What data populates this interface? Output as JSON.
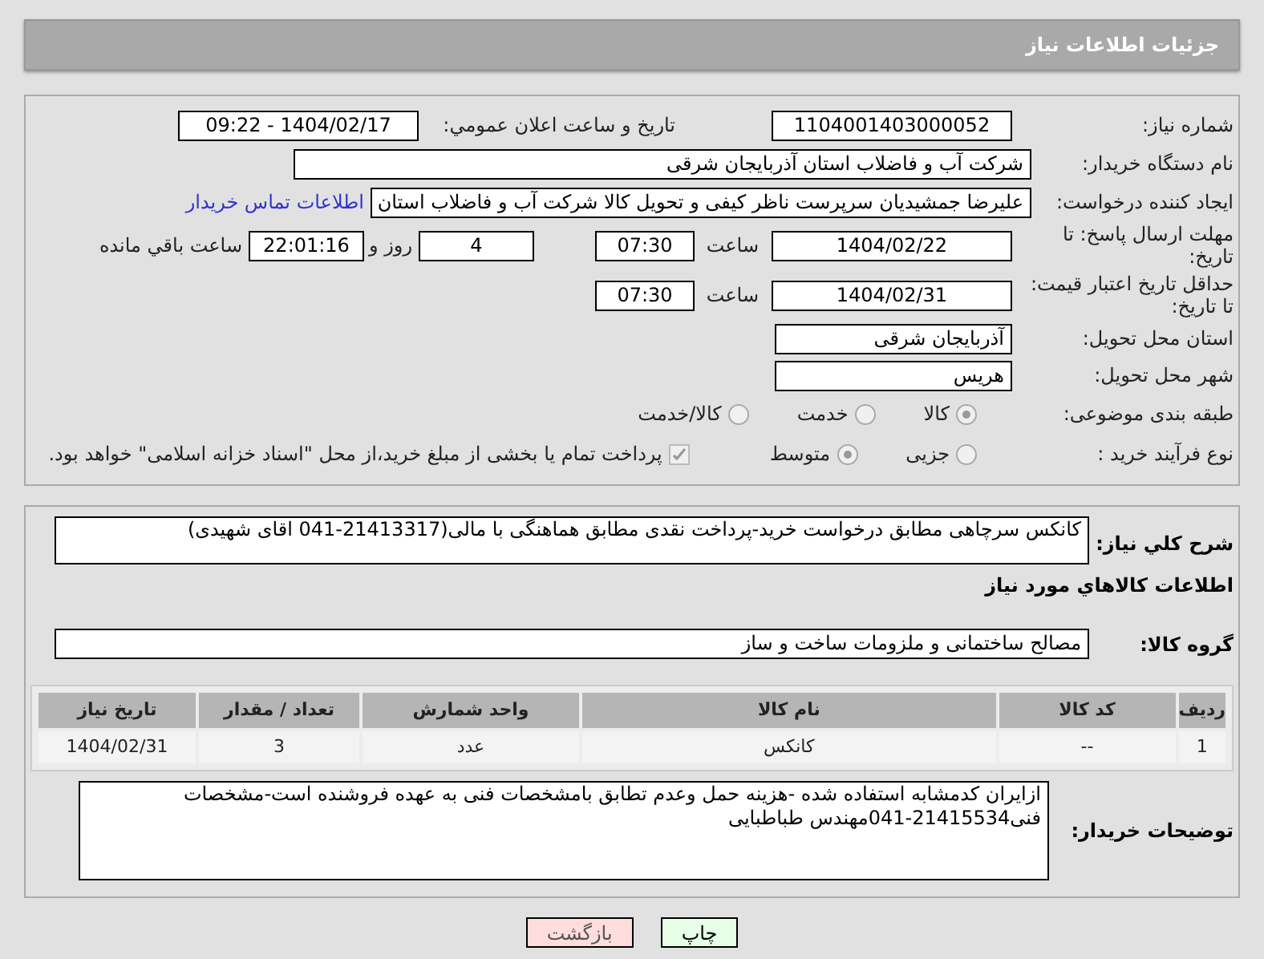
{
  "header": {
    "title": "جزئیات اطلاعات نیاز"
  },
  "need_number": {
    "label": "شماره نیاز:",
    "value": "1104001403000052"
  },
  "announce": {
    "label": "تاريخ و ساعت اعلان عمومي:",
    "value": "1404/02/17 - 09:22"
  },
  "buyer": {
    "label": "نام دستگاه خريدار:",
    "value": "شرکت آب و فاضلاب استان آذربایجان شرقی"
  },
  "creator": {
    "label": "ايجاد کننده درخواست:",
    "value": "علیرضا جمشیدیان سرپرست ناظر کیفی و تحویل کالا شرکت آب و فاضلاب استان",
    "link": "اطلاعات تماس خريدار"
  },
  "deadline": {
    "label": "مهلت ارسال پاسخ: تا تاريخ:",
    "date": "1404/02/22",
    "time_label": "ساعت",
    "time": "07:30",
    "days": "4",
    "days_label": "روز و",
    "remaining": "22:01:16",
    "remaining_label": "ساعت باقي مانده"
  },
  "validity": {
    "label": "حداقل تاريخ اعتبار قيمت: تا تاريخ:",
    "date": "1404/02/31",
    "time_label": "ساعت",
    "time": "07:30"
  },
  "province": {
    "label": "استان محل تحویل:",
    "value": "آذربایجان شرقی"
  },
  "city": {
    "label": "شهر محل تحویل:",
    "value": "هریس"
  },
  "category": {
    "label": "طبقه بندی موضوعی:",
    "options": [
      {
        "label": "کالا",
        "selected": true
      },
      {
        "label": "خدمت",
        "selected": false
      },
      {
        "label": "کالا/خدمت",
        "selected": false
      }
    ]
  },
  "process": {
    "label": "نوع فرآیند خرید :",
    "options": [
      {
        "label": "جزیی",
        "selected": false
      },
      {
        "label": "متوسط",
        "selected": true
      }
    ],
    "payment": {
      "checked": true,
      "label": "پرداخت تمام یا بخشی از مبلغ خرید،از محل \"اسناد خزانه اسلامی\" خواهد بود."
    }
  },
  "summary": {
    "label": "شرح کلي نياز:",
    "value": "کانکس سرچاهی مطابق درخواست خرید-پرداخت نقدی مطابق هماهنگی با مالی(21413317-041 اقای شهیدی)"
  },
  "goods_heading": "اطلاعات کالاهاي مورد نياز",
  "goods_group": {
    "label": "گروه کالا:",
    "value": "مصالح ساختمانی و ملزومات ساخت و ساز"
  },
  "table": {
    "columns": [
      "رديف",
      "کد کالا",
      "نام کالا",
      "واحد شمارش",
      "تعداد / مقدار",
      "تاريخ نياز"
    ],
    "rows": [
      [
        "1",
        "--",
        "کانکس",
        "عدد",
        "3",
        "1404/02/31"
      ]
    ]
  },
  "buyer_notes": {
    "label": "توضيحات خريدار:",
    "value": "ازایران کدمشابه استفاده شده -هزینه حمل وعدم تطابق بامشخصات فنی به عهده فروشنده است-مشخصات فنی21415534-041مهندس طباطبایی"
  },
  "buttons": [
    {
      "label": "چاپ",
      "kind": "print"
    },
    {
      "label": "بازگشت",
      "kind": "back"
    }
  ]
}
